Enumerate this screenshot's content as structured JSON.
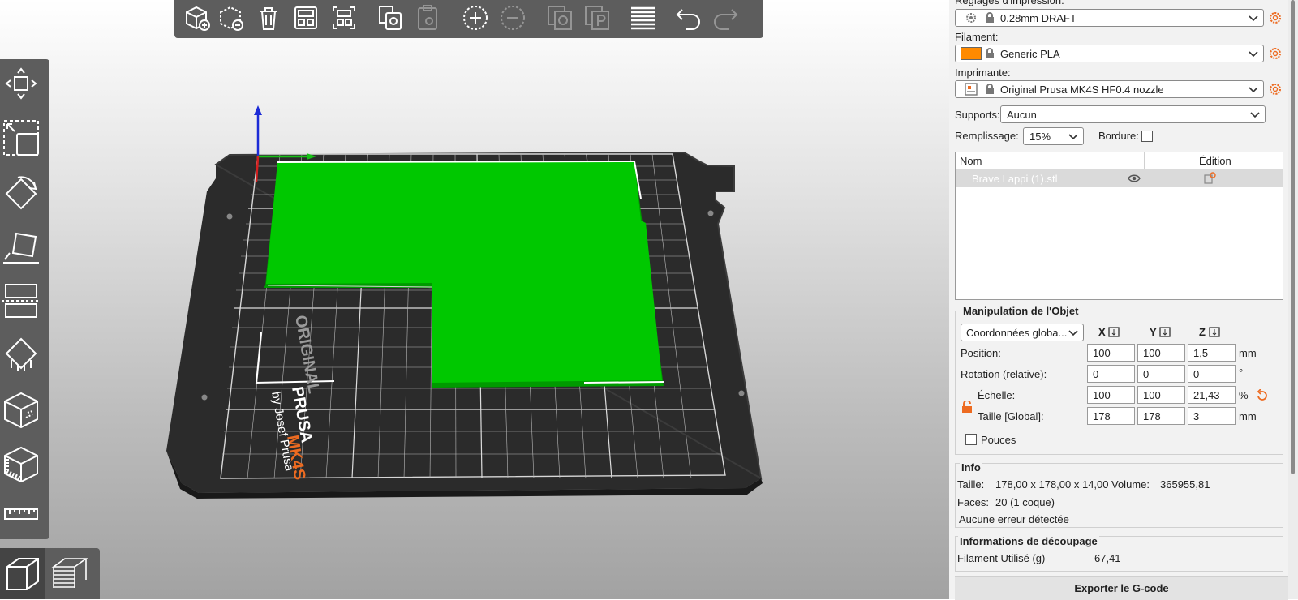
{
  "print_settings": {
    "section_label": "Réglages d'impression:",
    "profile": "0.28mm DRAFT",
    "filament_label": "Filament:",
    "filament": "Generic PLA",
    "filament_color": "#ff8a00",
    "printer_label": "Imprimante:",
    "printer": "Original Prusa MK4S HF0.4 nozzle",
    "supports_label": "Supports:",
    "supports": "Aucun",
    "infill_label": "Remplissage:",
    "infill": "15%",
    "brim_label": "Bordure:"
  },
  "object_list": {
    "columns": [
      "Nom",
      "Édition"
    ],
    "items": [
      {
        "name": "Brave Lappi (1).stl"
      }
    ]
  },
  "manipulation": {
    "title": "Manipulation de l'Objet",
    "coord_select": "Coordonnées globa...",
    "axes": [
      "X",
      "Y",
      "Z"
    ],
    "rows": [
      {
        "label": "Position:",
        "values": [
          "100",
          "100",
          "1,5"
        ],
        "unit": "mm"
      },
      {
        "label": "Rotation (relative):",
        "values": [
          "0",
          "0",
          "0"
        ],
        "unit": "°"
      },
      {
        "label": "Échelle:",
        "values": [
          "100",
          "100",
          "21,43"
        ],
        "unit": "%"
      },
      {
        "label": "Taille [Global]:",
        "values": [
          "178",
          "178",
          "3"
        ],
        "unit": "mm"
      }
    ],
    "inches_label": "Pouces"
  },
  "info": {
    "title": "Info",
    "size_label": "Taille:",
    "size": "178,00 x 178,00 x 14,00",
    "volume_label": "Volume:",
    "volume": "365955,81",
    "faces_label": "Faces:",
    "faces": "20 (1 coque)",
    "errors": "Aucune erreur détectée"
  },
  "slicing": {
    "title": "Informations de découpage",
    "filament_used_label": "Filament Utilisé (g)",
    "filament_used": "67,41"
  },
  "export_button": "Exporter le G-code",
  "bed": {
    "brand_line1": "ORIGINAL",
    "brand_line2": "PRUSA",
    "brand_model": "MK4S",
    "brand_by": "by Josef Prusa"
  },
  "colors": {
    "model": "#00c800",
    "accent": "#ed6b21",
    "toolbar": "#5d5d5d"
  },
  "icons": {
    "top_toolbar": [
      "add-icon",
      "delete-icon",
      "delete-all-icon",
      "arrange-icon",
      "split-icon",
      "copy-icon",
      "paste-icon",
      "add-instance-icon",
      "remove-instance-icon",
      "split-objects-icon",
      "split-parts-icon",
      "layers-editing-icon",
      "undo-icon",
      "redo-icon"
    ],
    "left_toolbar": [
      "move-icon",
      "scale-icon",
      "rotate-icon",
      "place-on-face-icon",
      "cut-icon",
      "paint-supports-icon",
      "seam-icon",
      "mmu-paint-icon",
      "measure-icon"
    ],
    "view_toggle": [
      "3d-view-icon",
      "preview-icon"
    ]
  }
}
